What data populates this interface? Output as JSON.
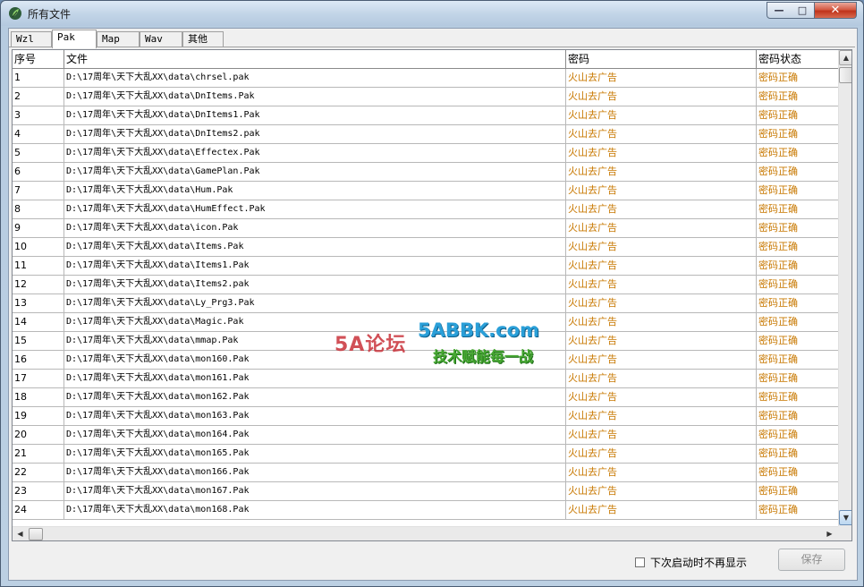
{
  "window": {
    "title": "所有文件"
  },
  "tabs": [
    {
      "label": "Wzl"
    },
    {
      "label": "Pak"
    },
    {
      "label": "Map"
    },
    {
      "label": "Wav"
    },
    {
      "label": "其他"
    }
  ],
  "table": {
    "columns": [
      "序号",
      "文件",
      "密码",
      "密码状态"
    ],
    "rows": [
      [
        "1",
        "D:\\17周年\\天下大乱XX\\data\\chrsel.pak",
        "火山去广告",
        "密码正确"
      ],
      [
        "2",
        "D:\\17周年\\天下大乱XX\\data\\DnItems.Pak",
        "火山去广告",
        "密码正确"
      ],
      [
        "3",
        "D:\\17周年\\天下大乱XX\\data\\DnItems1.Pak",
        "火山去广告",
        "密码正确"
      ],
      [
        "4",
        "D:\\17周年\\天下大乱XX\\data\\DnItems2.pak",
        "火山去广告",
        "密码正确"
      ],
      [
        "5",
        "D:\\17周年\\天下大乱XX\\data\\Effectex.Pak",
        "火山去广告",
        "密码正确"
      ],
      [
        "6",
        "D:\\17周年\\天下大乱XX\\data\\GamePlan.Pak",
        "火山去广告",
        "密码正确"
      ],
      [
        "7",
        "D:\\17周年\\天下大乱XX\\data\\Hum.Pak",
        "火山去广告",
        "密码正确"
      ],
      [
        "8",
        "D:\\17周年\\天下大乱XX\\data\\HumEffect.Pak",
        "火山去广告",
        "密码正确"
      ],
      [
        "9",
        "D:\\17周年\\天下大乱XX\\data\\icon.Pak",
        "火山去广告",
        "密码正确"
      ],
      [
        "10",
        "D:\\17周年\\天下大乱XX\\data\\Items.Pak",
        "火山去广告",
        "密码正确"
      ],
      [
        "11",
        "D:\\17周年\\天下大乱XX\\data\\Items1.Pak",
        "火山去广告",
        "密码正确"
      ],
      [
        "12",
        "D:\\17周年\\天下大乱XX\\data\\Items2.pak",
        "火山去广告",
        "密码正确"
      ],
      [
        "13",
        "D:\\17周年\\天下大乱XX\\data\\Ly_Prg3.Pak",
        "火山去广告",
        "密码正确"
      ],
      [
        "14",
        "D:\\17周年\\天下大乱XX\\data\\Magic.Pak",
        "火山去广告",
        "密码正确"
      ],
      [
        "15",
        "D:\\17周年\\天下大乱XX\\data\\mmap.Pak",
        "火山去广告",
        "密码正确"
      ],
      [
        "16",
        "D:\\17周年\\天下大乱XX\\data\\mon160.Pak",
        "火山去广告",
        "密码正确"
      ],
      [
        "17",
        "D:\\17周年\\天下大乱XX\\data\\mon161.Pak",
        "火山去广告",
        "密码正确"
      ],
      [
        "18",
        "D:\\17周年\\天下大乱XX\\data\\mon162.Pak",
        "火山去广告",
        "密码正确"
      ],
      [
        "19",
        "D:\\17周年\\天下大乱XX\\data\\mon163.Pak",
        "火山去广告",
        "密码正确"
      ],
      [
        "20",
        "D:\\17周年\\天下大乱XX\\data\\mon164.Pak",
        "火山去广告",
        "密码正确"
      ],
      [
        "21",
        "D:\\17周年\\天下大乱XX\\data\\mon165.Pak",
        "火山去广告",
        "密码正确"
      ],
      [
        "22",
        "D:\\17周年\\天下大乱XX\\data\\mon166.Pak",
        "火山去广告",
        "密码正确"
      ],
      [
        "23",
        "D:\\17周年\\天下大乱XX\\data\\mon167.Pak",
        "火山去广告",
        "密码正确"
      ],
      [
        "24",
        "D:\\17周年\\天下大乱XX\\data\\mon168.Pak",
        "火山去广告",
        "密码正确"
      ]
    ]
  },
  "footer": {
    "checkbox_label": "下次启动时不再显示",
    "save_label": "保存"
  },
  "watermark": {
    "logo": "5A论坛",
    "domain": "5ABBK.com",
    "slogan": "技术赋能每一战"
  },
  "colors": {
    "password_text": "#c87800",
    "status_text": "#c87800",
    "selection": "#3399ff"
  }
}
